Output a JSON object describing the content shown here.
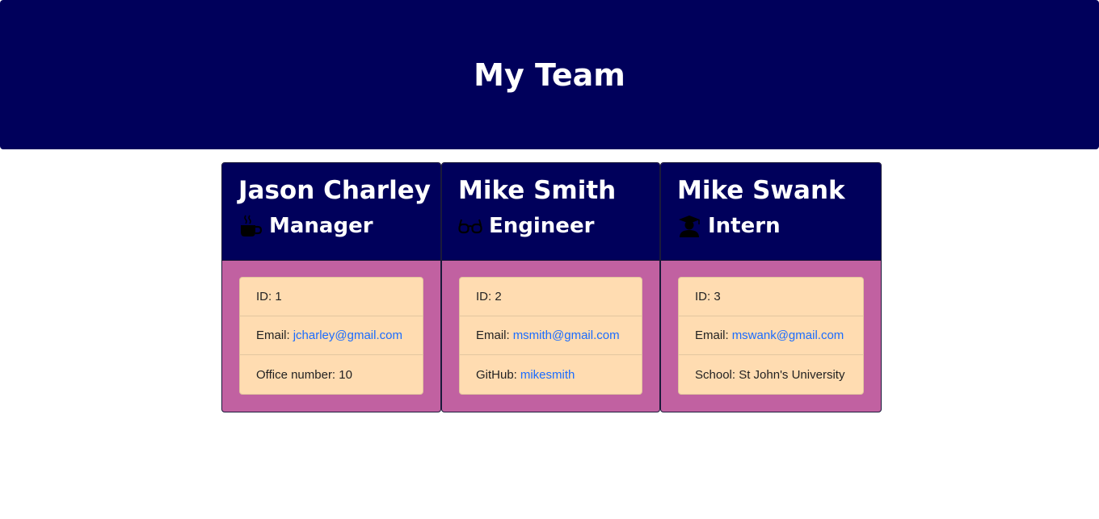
{
  "header": {
    "title": "My Team"
  },
  "colors": {
    "header_bg": "#00005b",
    "card_body_bg": "#c161a1",
    "list_bg": "#ffdcb1",
    "link": "#1a6cff"
  },
  "team": [
    {
      "name": "Jason Charley",
      "role": "Manager",
      "role_icon": "coffee-mug-icon",
      "id_label": "ID: 1",
      "email_label": "Email:",
      "email": "jcharley@gmail.com",
      "extra_label": "Office number: 10",
      "extra_value": ""
    },
    {
      "name": "Mike Smith",
      "role": "Engineer",
      "role_icon": "glasses-icon",
      "id_label": "ID: 2",
      "email_label": "Email:",
      "email": "msmith@gmail.com",
      "extra_label": "GitHub:",
      "extra_value": "mikesmith"
    },
    {
      "name": "Mike Swank",
      "role": "Intern",
      "role_icon": "graduate-icon",
      "id_label": "ID: 3",
      "email_label": "Email:",
      "email": "mswank@gmail.com",
      "extra_label": "School: St John's University",
      "extra_value": ""
    }
  ]
}
